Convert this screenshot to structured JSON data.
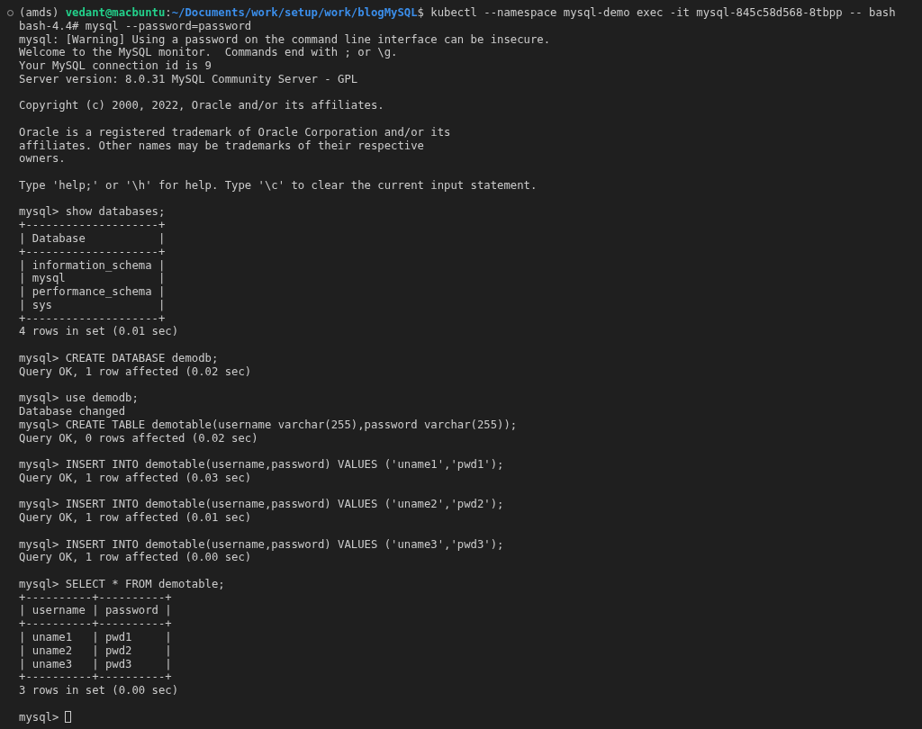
{
  "terminal": {
    "command_line": {
      "env": "(amds)",
      "user_host": "vedant@macbuntu",
      "separator": ":",
      "path": "~/Documents/work/setup/work/blogMySQL",
      "command": "$ kubectl --namespace mysql-demo exec -it mysql-845c58d568-8tbpp -- bash"
    },
    "lines": [
      {
        "kind": "text",
        "text": "bash-4.4# mysql --password=password"
      },
      {
        "kind": "text",
        "text": "mysql: [Warning] Using a password on the command line interface can be insecure."
      },
      {
        "kind": "text",
        "text": "Welcome to the MySQL monitor.  Commands end with ; or \\g."
      },
      {
        "kind": "text",
        "text": "Your MySQL connection id is 9"
      },
      {
        "kind": "text",
        "text": "Server version: 8.0.31 MySQL Community Server - GPL"
      },
      {
        "kind": "blank"
      },
      {
        "kind": "text",
        "text": "Copyright (c) 2000, 2022, Oracle and/or its affiliates."
      },
      {
        "kind": "blank"
      },
      {
        "kind": "text",
        "text": "Oracle is a registered trademark of Oracle Corporation and/or its"
      },
      {
        "kind": "text",
        "text": "affiliates. Other names may be trademarks of their respective"
      },
      {
        "kind": "text",
        "text": "owners."
      },
      {
        "kind": "blank"
      },
      {
        "kind": "text",
        "text": "Type 'help;' or '\\h' for help. Type '\\c' to clear the current input statement."
      },
      {
        "kind": "blank"
      },
      {
        "kind": "text",
        "text": "mysql> show databases;"
      },
      {
        "kind": "text",
        "text": "+--------------------+"
      },
      {
        "kind": "text",
        "text": "| Database           |"
      },
      {
        "kind": "text",
        "text": "+--------------------+"
      },
      {
        "kind": "text",
        "text": "| information_schema |"
      },
      {
        "kind": "text",
        "text": "| mysql              |"
      },
      {
        "kind": "text",
        "text": "| performance_schema |"
      },
      {
        "kind": "text",
        "text": "| sys                |"
      },
      {
        "kind": "text",
        "text": "+--------------------+"
      },
      {
        "kind": "text",
        "text": "4 rows in set (0.01 sec)"
      },
      {
        "kind": "blank"
      },
      {
        "kind": "text",
        "text": "mysql> CREATE DATABASE demodb;"
      },
      {
        "kind": "text",
        "text": "Query OK, 1 row affected (0.02 sec)"
      },
      {
        "kind": "blank"
      },
      {
        "kind": "text",
        "text": "mysql> use demodb;"
      },
      {
        "kind": "text",
        "text": "Database changed"
      },
      {
        "kind": "text",
        "text": "mysql> CREATE TABLE demotable(username varchar(255),password varchar(255));"
      },
      {
        "kind": "text",
        "text": "Query OK, 0 rows affected (0.02 sec)"
      },
      {
        "kind": "blank"
      },
      {
        "kind": "text",
        "text": "mysql> INSERT INTO demotable(username,password) VALUES ('uname1','pwd1');"
      },
      {
        "kind": "text",
        "text": "Query OK, 1 row affected (0.03 sec)"
      },
      {
        "kind": "blank"
      },
      {
        "kind": "text",
        "text": "mysql> INSERT INTO demotable(username,password) VALUES ('uname2','pwd2');"
      },
      {
        "kind": "text",
        "text": "Query OK, 1 row affected (0.01 sec)"
      },
      {
        "kind": "blank"
      },
      {
        "kind": "text",
        "text": "mysql> INSERT INTO demotable(username,password) VALUES ('uname3','pwd3');"
      },
      {
        "kind": "text",
        "text": "Query OK, 1 row affected (0.00 sec)"
      },
      {
        "kind": "blank"
      },
      {
        "kind": "text",
        "text": "mysql> SELECT * FROM demotable;"
      },
      {
        "kind": "text",
        "text": "+----------+----------+"
      },
      {
        "kind": "text",
        "text": "| username | password |"
      },
      {
        "kind": "text",
        "text": "+----------+----------+"
      },
      {
        "kind": "text",
        "text": "| uname1   | pwd1     |"
      },
      {
        "kind": "text",
        "text": "| uname2   | pwd2     |"
      },
      {
        "kind": "text",
        "text": "| uname3   | pwd3     |"
      },
      {
        "kind": "text",
        "text": "+----------+----------+"
      },
      {
        "kind": "text",
        "text": "3 rows in set (0.00 sec)"
      },
      {
        "kind": "blank"
      },
      {
        "kind": "prompt",
        "text": "mysql>"
      }
    ]
  }
}
